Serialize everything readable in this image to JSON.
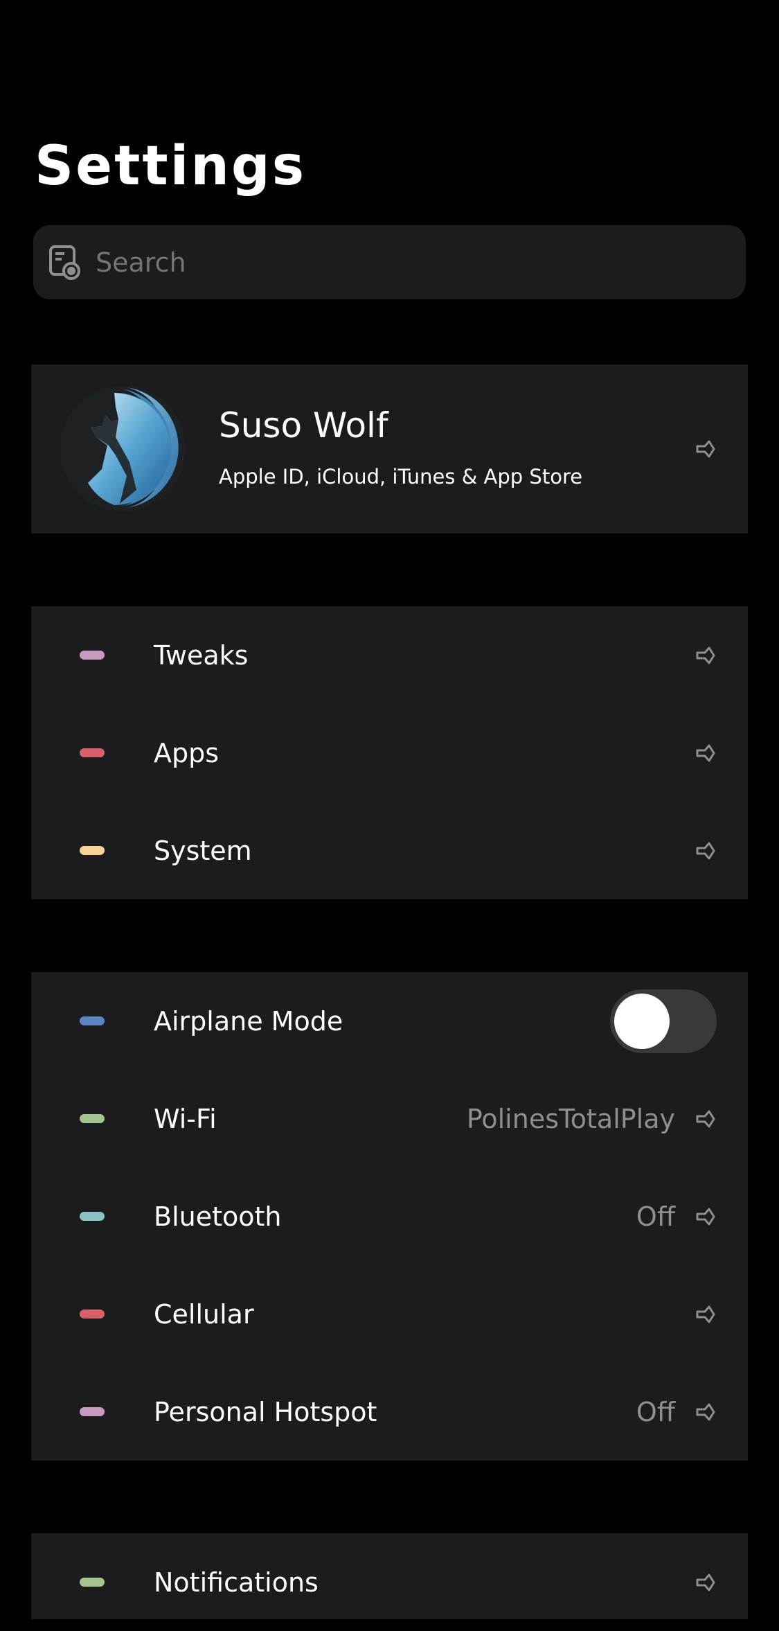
{
  "header": {
    "title": "Settings"
  },
  "search": {
    "placeholder": "Search"
  },
  "profile": {
    "name": "Suso Wolf",
    "subtitle": "Apple ID, iCloud, iTunes & App Store"
  },
  "groups": [
    {
      "rows": [
        {
          "label": "Tweaks",
          "dot_color": "#c79ac0",
          "value": ""
        },
        {
          "label": "Apps",
          "dot_color": "#d9606a",
          "value": ""
        },
        {
          "label": "System",
          "dot_color": "#f4d597",
          "value": ""
        }
      ]
    },
    {
      "rows": [
        {
          "label": "Airplane Mode",
          "dot_color": "#5b86c6",
          "toggle_on": false
        },
        {
          "label": "Wi-Fi",
          "dot_color": "#a6c48f",
          "value": "PolinesTotalPlay"
        },
        {
          "label": "Bluetooth",
          "dot_color": "#8ac3c1",
          "value": "Off"
        },
        {
          "label": "Cellular",
          "dot_color": "#d9606a",
          "value": ""
        },
        {
          "label": "Personal Hotspot",
          "dot_color": "#c79ac0",
          "value": "Off"
        }
      ]
    },
    {
      "rows": [
        {
          "label": "Notifications",
          "dot_color": "#a6c48f",
          "value": ""
        }
      ]
    }
  ],
  "icons": {
    "search": "search-icon",
    "chevron": "chevron-right-icon",
    "avatar": "wolf-logo-avatar"
  },
  "colors": {
    "background": "#000000",
    "cell": "#1c1c1e",
    "secondary_text": "#8e8e93",
    "toggle_track": "#39393d"
  }
}
